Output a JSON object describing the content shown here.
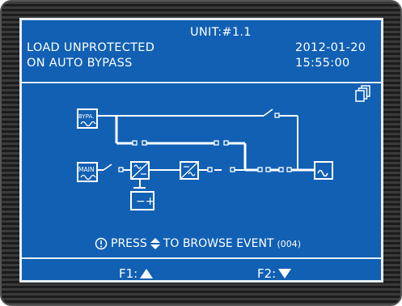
{
  "header": {
    "unit": "UNIT:#1.1",
    "status_line1": "LOAD UNPROTECTED",
    "status_line2": "ON AUTO BYPASS",
    "date": "2012-01-20",
    "time": "15:55:00"
  },
  "diagram": {
    "bypass_label": "BYPA.",
    "main_label": "MAIN"
  },
  "footer": {
    "message_prefix": "PRESS",
    "message_suffix": "TO BROWSE EVENT",
    "event_count": "(004)",
    "f1_label": "F1:",
    "f2_label": "F2:"
  },
  "icons": {
    "pages": "pages-icon",
    "info": "info-icon",
    "updown": "up-down-arrow-icon",
    "up": "triangle-up-icon",
    "down": "triangle-down-icon"
  },
  "colors": {
    "screen": "#1160b3",
    "line": "#ffffff"
  }
}
